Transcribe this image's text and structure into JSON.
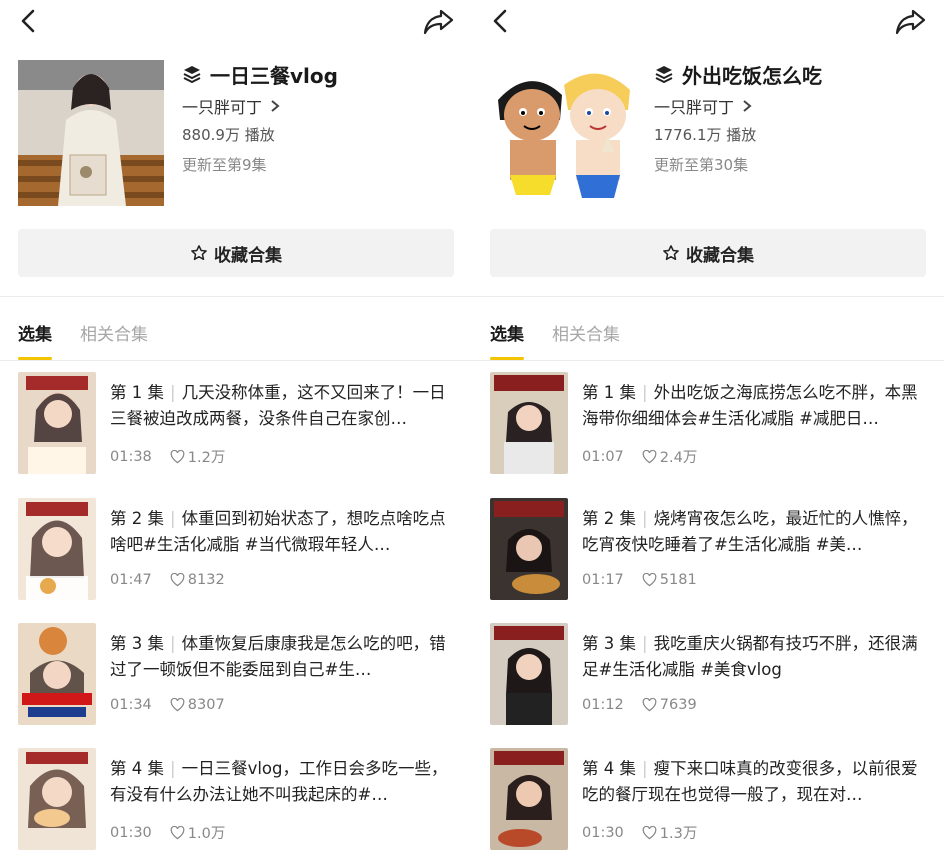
{
  "left": {
    "title": "一日三餐vlog",
    "author": "一只胖可丁",
    "plays": "880.9万 播放",
    "updated": "更新至第9集",
    "collect_label": "收藏合集",
    "tabs": [
      "选集",
      "相关合集"
    ],
    "episodes": [
      {
        "num": "第 1 集",
        "desc": "几天没称体重，这不又回来了！一日三餐被迫改成两餐，没条件自己在家创…",
        "duration": "01:38",
        "likes": "1.2万"
      },
      {
        "num": "第 2 集",
        "desc": "体重回到初始状态了，想吃点啥吃点啥吧#生活化减脂 #当代微瑕年轻人…",
        "duration": "01:47",
        "likes": "8132"
      },
      {
        "num": "第 3 集",
        "desc": "体重恢复后康康我是怎么吃的吧，错过了一顿饭但不能委屈到自己#生…",
        "duration": "01:34",
        "likes": "8307"
      },
      {
        "num": "第 4 集",
        "desc": "一日三餐vlog，工作日会多吃一些，有没有什么办法让她不叫我起床的#…",
        "duration": "01:30",
        "likes": "1.0万"
      }
    ]
  },
  "right": {
    "title": "外出吃饭怎么吃",
    "author": "一只胖可丁",
    "plays": "1776.1万 播放",
    "updated": "更新至第30集",
    "collect_label": "收藏合集",
    "tabs": [
      "选集",
      "相关合集"
    ],
    "episodes": [
      {
        "num": "第 1 集",
        "desc": "外出吃饭之海底捞怎么吃不胖，本黑海带你细细体会#生活化减脂 #减肥日…",
        "duration": "01:07",
        "likes": "2.4万"
      },
      {
        "num": "第 2 集",
        "desc": "烧烤宵夜怎么吃，最近忙的人憔悴，吃宵夜快吃睡着了#生活化减脂 #美…",
        "duration": "01:17",
        "likes": "5181"
      },
      {
        "num": "第 3 集",
        "desc": "我吃重庆火锅都有技巧不胖，还很满足#生活化减脂 #美食vlog",
        "duration": "01:12",
        "likes": "7639"
      },
      {
        "num": "第 4 集",
        "desc": "瘦下来口味真的改变很多，以前很爱吃的餐厅现在也觉得一般了，现在对…",
        "duration": "01:30",
        "likes": "1.3万"
      }
    ]
  },
  "icons": [
    "back-icon",
    "share-icon",
    "layers-icon",
    "chevron-right-icon",
    "star-outline-icon",
    "heart-outline-icon"
  ],
  "colors": {
    "accent_underline": "#f5c400",
    "muted_text": "#888888",
    "button_bg": "#f2f2f2"
  }
}
